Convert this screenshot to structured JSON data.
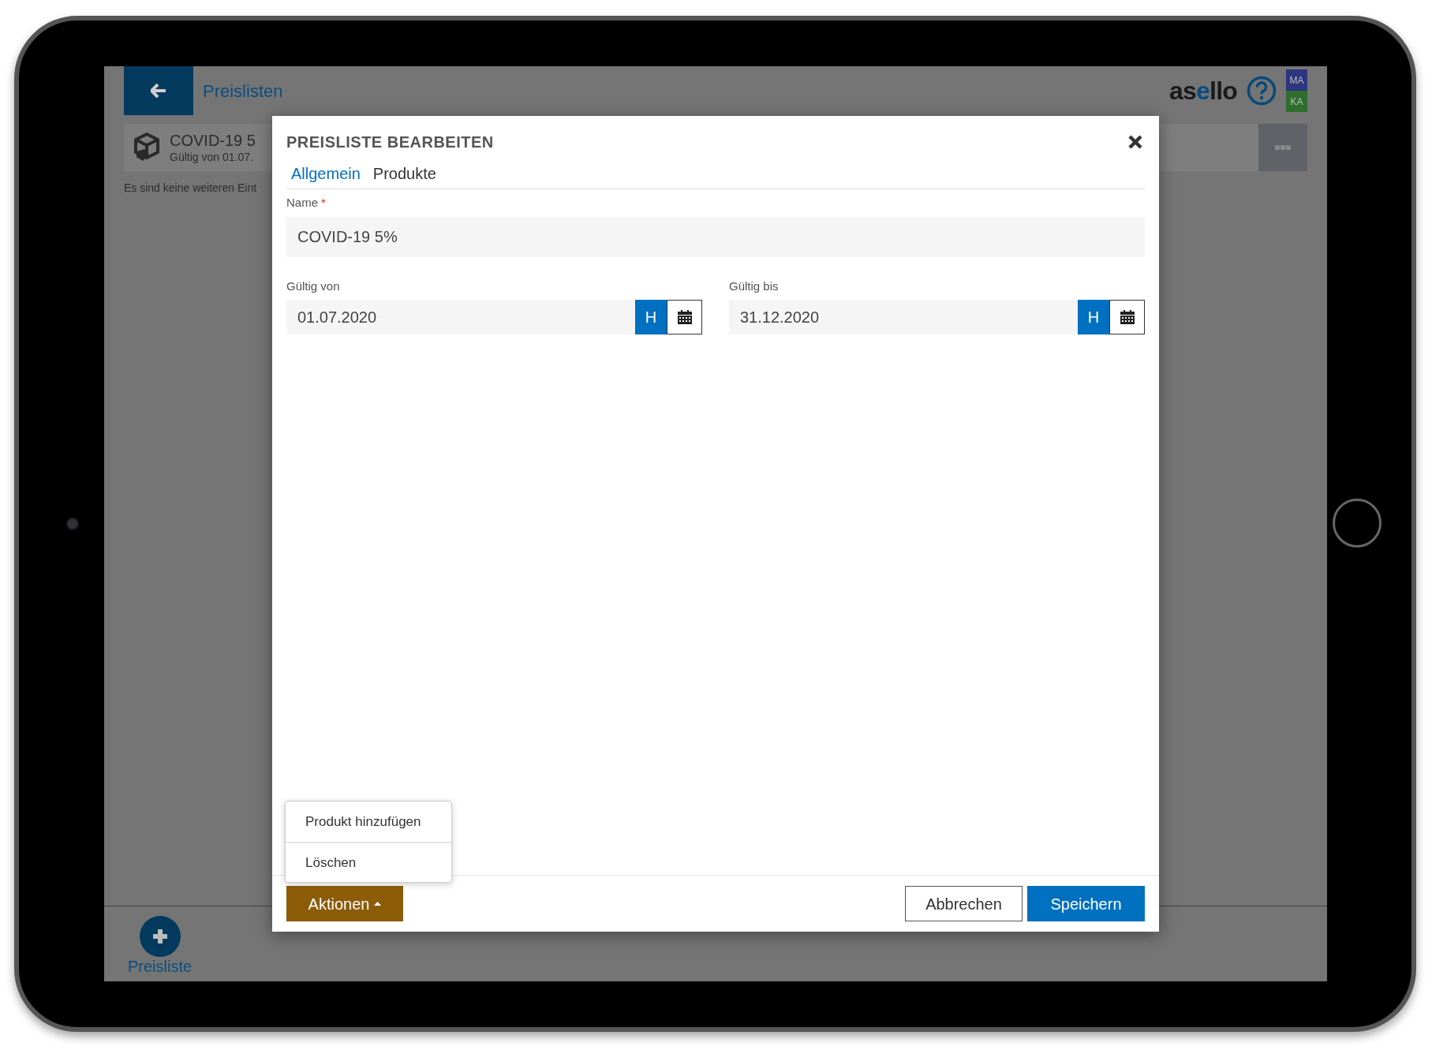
{
  "app_bar": {
    "title": "Preislisten",
    "logo": "asello",
    "users": [
      {
        "initials": "MA",
        "color": "#2d3580"
      },
      {
        "initials": "KA",
        "color": "#2e6e2e"
      }
    ]
  },
  "list": {
    "items": [
      {
        "name": "COVID-19 5",
        "subtitle": "Gültig von 01.07."
      }
    ],
    "empty_note": "Es sind keine weiteren Eint"
  },
  "bottom_bar": {
    "add_label": "Preisliste"
  },
  "dialog": {
    "title": "PREISLISTE BEARBEITEN",
    "tabs": [
      {
        "label": "Allgemein",
        "selected": true
      },
      {
        "label": "Produkte",
        "selected": false
      }
    ],
    "name_field": {
      "label": "Name",
      "required_mark": "*",
      "value": "COVID-19 5%"
    },
    "date_fields": [
      {
        "label": "Gültig von",
        "value": "01.07.2020",
        "today_button": "H"
      },
      {
        "label": "Gültig bis",
        "value": "31.12.2020",
        "today_button": "H"
      }
    ],
    "actions_menu": {
      "open": true,
      "items": [
        "Produkt hinzufügen",
        "Löschen"
      ]
    },
    "actions_button": "Aktionen",
    "cancel_button": "Abbrechen",
    "save_button": "Speichern"
  }
}
